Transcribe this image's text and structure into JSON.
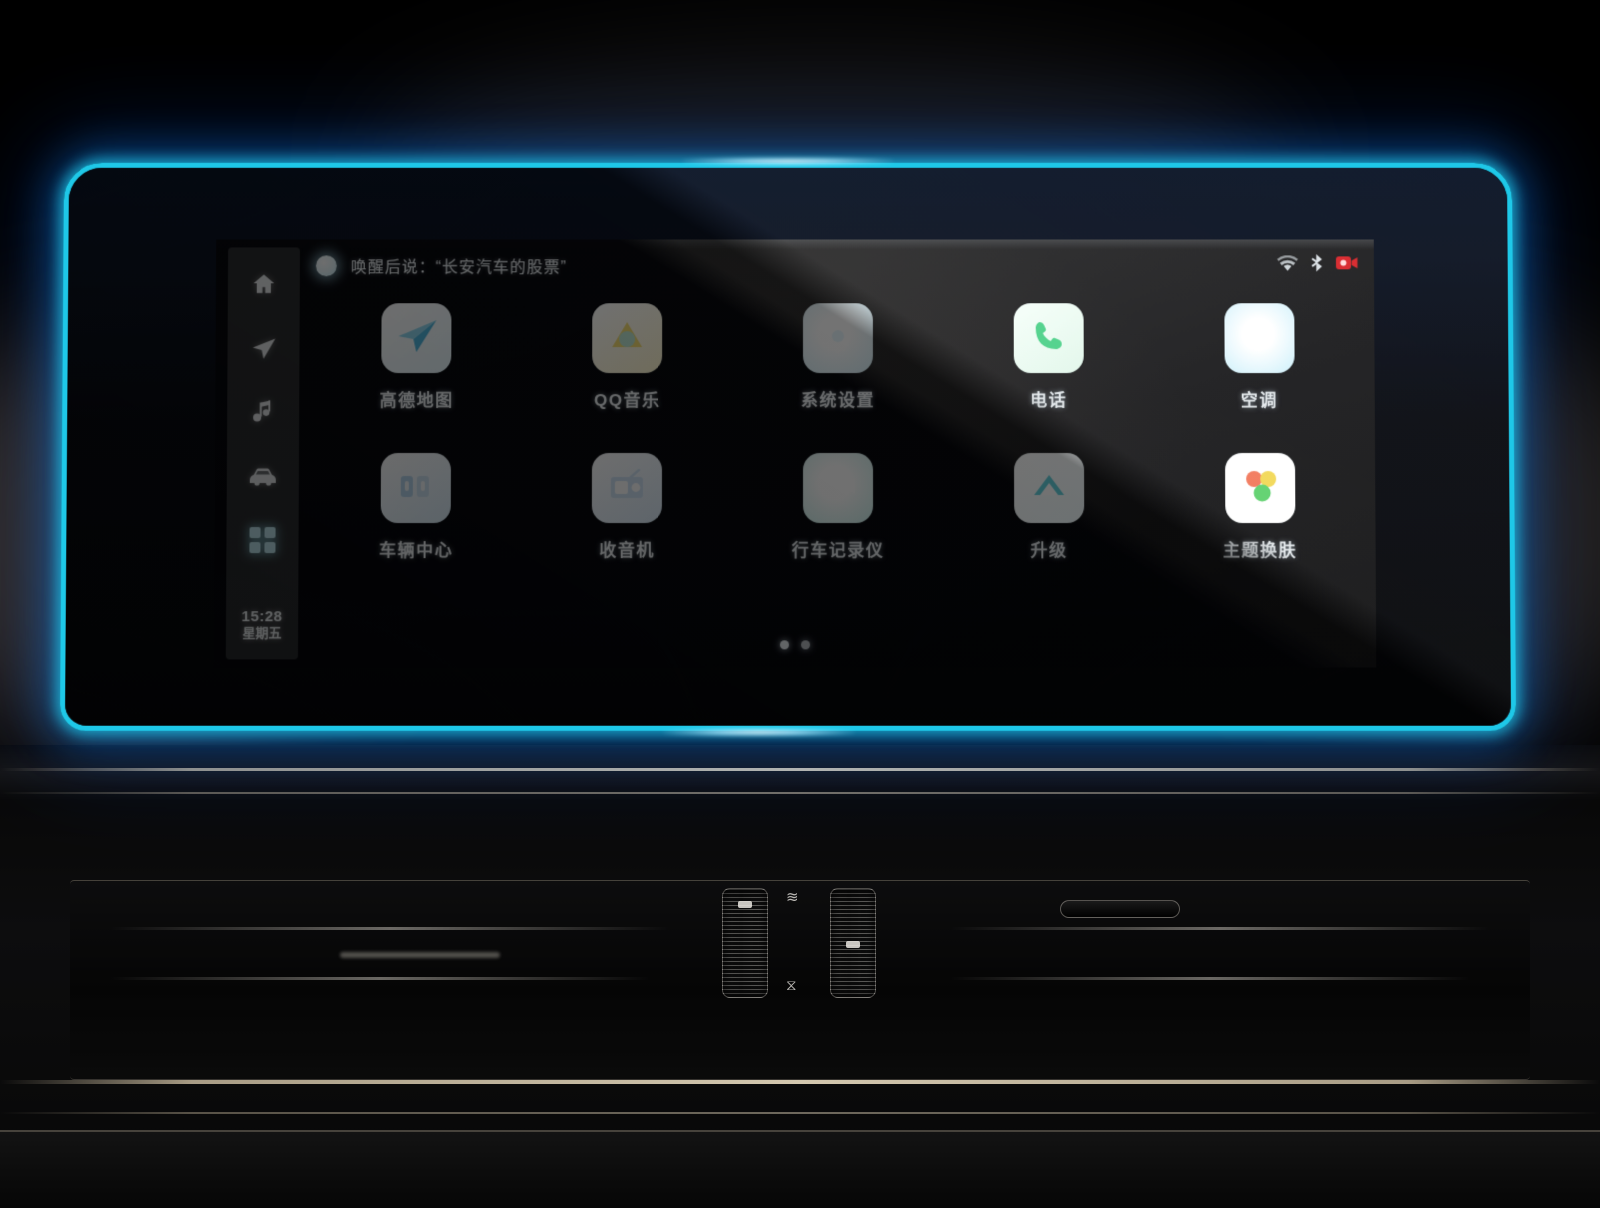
{
  "screen": {
    "voice_prompt": "唤醒后说：“长安汽车的股票”",
    "status_icons": [
      "wifi-icon",
      "bluetooth-icon",
      "recording-icon"
    ],
    "clock": {
      "time": "15:28",
      "weekday": "星期五"
    },
    "page_dots": {
      "count": 2,
      "active_index": 0
    }
  },
  "sidebar": {
    "items": [
      {
        "name": "home-icon",
        "label": "主页",
        "active": false
      },
      {
        "name": "navigation-icon",
        "label": "导航",
        "active": false
      },
      {
        "name": "music-icon",
        "label": "音乐",
        "active": false
      },
      {
        "name": "car-icon",
        "label": "车辆",
        "active": false
      },
      {
        "name": "apps-grid-icon",
        "label": "应用",
        "active": true
      }
    ]
  },
  "apps": [
    {
      "label": "高德地图",
      "icon": "map-plane-icon",
      "tile": "#f2fbfe",
      "accent": "#66c8e8"
    },
    {
      "label": "QQ音乐",
      "icon": "music-note-icon",
      "tile": "#fdfcf0",
      "accent": "#f0d24a"
    },
    {
      "label": "系统设置",
      "icon": "gear-icon",
      "tile": "#dff6fd",
      "accent": "#9fd8ea"
    },
    {
      "label": "电话",
      "icon": "phone-icon",
      "tile": "#eefaf2",
      "accent": "#3fcf7a"
    },
    {
      "label": "空调",
      "icon": "climate-icon",
      "tile": "#e2f8fe",
      "accent": "#8fd9ee"
    },
    {
      "label": "车辆中心",
      "icon": "vehicle-icon",
      "tile": "#e7f2fb",
      "accent": "#7aa9d8"
    },
    {
      "label": "收音机",
      "icon": "radio-icon",
      "tile": "#e9f4fd",
      "accent": "#8dbfe2"
    },
    {
      "label": "行车记录仪",
      "icon": "dashcam-icon",
      "tile": "#e6fbfb",
      "accent": "#7fd8d4"
    },
    {
      "label": "升级",
      "icon": "upgrade-icon",
      "tile": "#fbfeff",
      "accent": "#5ecfd8"
    },
    {
      "label": "主题换肤",
      "icon": "theme-skin-icon",
      "tile": "#ffffff",
      "accent": "#f28b6a"
    }
  ],
  "theme": {
    "bezel_glow": "#1ec8e8",
    "bezel_glow_outer": "#1478dc",
    "screen_bg": "#2a2a2b",
    "text_primary": "#eef2f4"
  },
  "console": {
    "left_wheel": "temperature-wheel",
    "right_wheel": "volume-wheel",
    "top_symbol": "≋",
    "bottom_symbol": "⧖"
  }
}
